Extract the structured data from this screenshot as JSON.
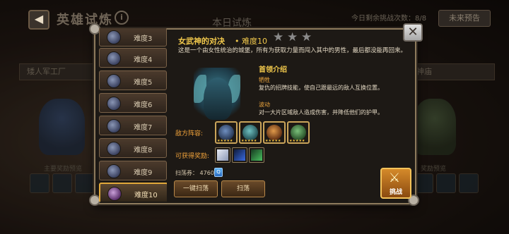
{
  "header": {
    "title": "英雄试炼",
    "info_icon": "info-icon",
    "tab_title": "本日试炼",
    "remaining": "今日剩余挑战次数：8/8",
    "preview_button": "未来预告"
  },
  "background": {
    "left_banner": "矮人军工厂",
    "right_banner": "神庙",
    "left_reward_label": "主要奖励预览",
    "right_reward_label": "奖励预览"
  },
  "difficulty_list": [
    {
      "label": "难度3",
      "active": false
    },
    {
      "label": "难度4",
      "active": false
    },
    {
      "label": "难度5",
      "active": false
    },
    {
      "label": "难度6",
      "active": false
    },
    {
      "label": "难度7",
      "active": false
    },
    {
      "label": "难度8",
      "active": false
    },
    {
      "label": "难度9",
      "active": false
    },
    {
      "label": "难度10",
      "active": true
    }
  ],
  "boss": {
    "title": "女武神的对决",
    "separator": "•",
    "level": "难度10",
    "stars_total": 3,
    "stars_earned": 0,
    "description": "这是一个由女性统治的城堡，所有为获取力量而闯入其中的男性，最后都没能再回来。",
    "intro_heading": "首领介绍",
    "skills": [
      {
        "name": "牺牲",
        "desc": "复仇的招牌技能，使自己跟最远的敌人互换位置。"
      },
      {
        "name": "波动",
        "desc": "对一大片区域敌人造成伤害，并降低他们的护甲。"
      }
    ]
  },
  "enemy_lineup": {
    "label": "敌方阵容:",
    "heroes": [
      {
        "name": "hero-1",
        "color": "#4a6f9a"
      },
      {
        "name": "hero-2",
        "color": "#3f8a8a"
      },
      {
        "name": "hero-3",
        "color": "#b86a2a"
      },
      {
        "name": "hero-4",
        "color": "#4a8a4a"
      }
    ]
  },
  "rewards": {
    "label": "可获得奖励:",
    "items": [
      {
        "name": "scroll-icon",
        "color": "#c9d4ea"
      },
      {
        "name": "blue-sword-icon",
        "color": "#2a58c0"
      },
      {
        "name": "green-staff-icon",
        "color": "#3aa050"
      }
    ]
  },
  "sweep": {
    "label": "扫荡券：",
    "count": "4760"
  },
  "buttons": {
    "sweep_all": "一键扫荡",
    "sweep": "扫荡",
    "fight": "挑战"
  }
}
